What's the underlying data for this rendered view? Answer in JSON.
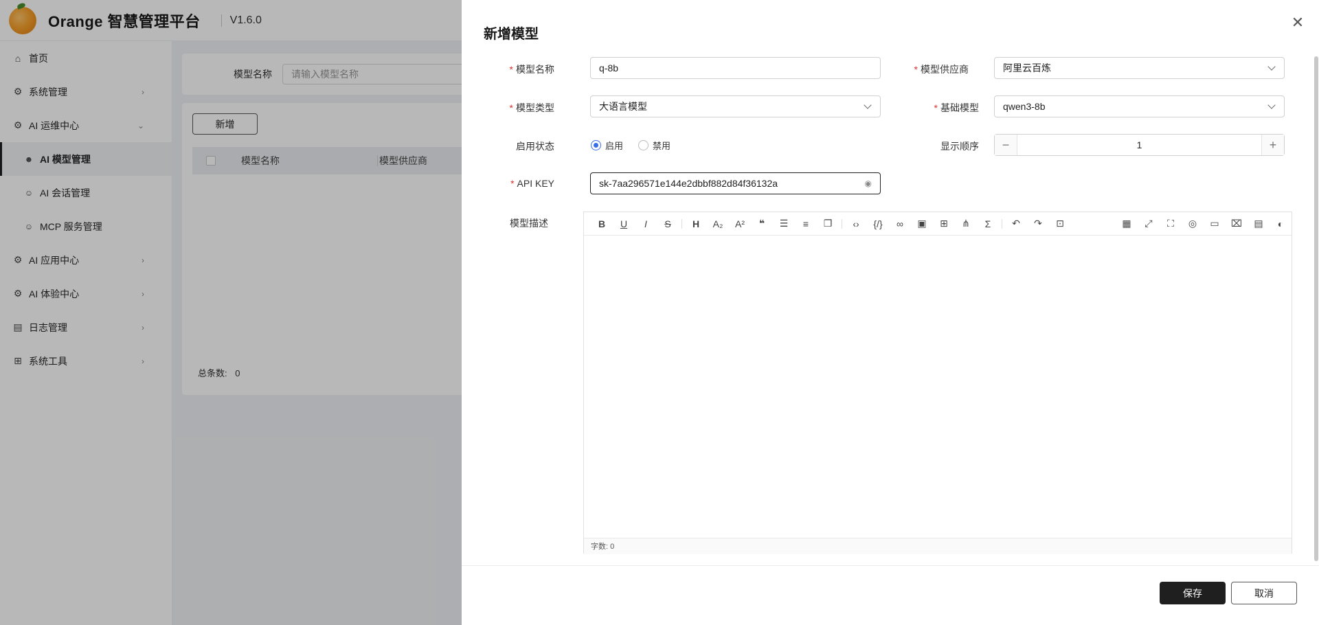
{
  "app": {
    "brand": "Orange 智慧管理平台",
    "version": "V1.6.0"
  },
  "sidebar": {
    "items": [
      {
        "label": "首页",
        "icon": "home-icon"
      },
      {
        "label": "系统管理",
        "icon": "gear-icon"
      },
      {
        "label": "AI 运维中心",
        "icon": "gear-icon"
      },
      {
        "label": "AI 模型管理",
        "icon": "robot-icon"
      },
      {
        "label": "AI 会话管理",
        "icon": "robot-icon"
      },
      {
        "label": "MCP 服务管理",
        "icon": "robot-icon"
      },
      {
        "label": "AI 应用中心",
        "icon": "gear-icon"
      },
      {
        "label": "AI 体验中心",
        "icon": "gear-icon"
      },
      {
        "label": "日志管理",
        "icon": "document-icon"
      },
      {
        "label": "系统工具",
        "icon": "grid-icon"
      }
    ]
  },
  "search": {
    "label": "模型名称",
    "placeholder": "请输入模型名称"
  },
  "table": {
    "add_label": "新增",
    "columns": [
      "模型名称",
      "模型供应商"
    ],
    "total_label": "总条数:",
    "total_value": "0"
  },
  "drawer": {
    "title": "新增模型",
    "form": {
      "name_label": "模型名称",
      "name_value": "q-8b",
      "provider_label": "模型供应商",
      "provider_value": "阿里云百炼",
      "type_label": "模型类型",
      "type_value": "大语言模型",
      "base_label": "基础模型",
      "base_value": "qwen3-8b",
      "status_label": "启用状态",
      "status_on": "启用",
      "status_off": "禁用",
      "order_label": "显示顺序",
      "order_value": "1",
      "apikey_label": "API KEY",
      "apikey_value": "sk-7aa296571e144e2dbbf882d84f36132a",
      "desc_label": "模型描述",
      "word_count": "字数: 0"
    },
    "save_label": "保存",
    "cancel_label": "取消"
  },
  "colors": {
    "accent": "#1f1f1f",
    "radio_active": "#3a6ee8",
    "required": "#e03030"
  }
}
